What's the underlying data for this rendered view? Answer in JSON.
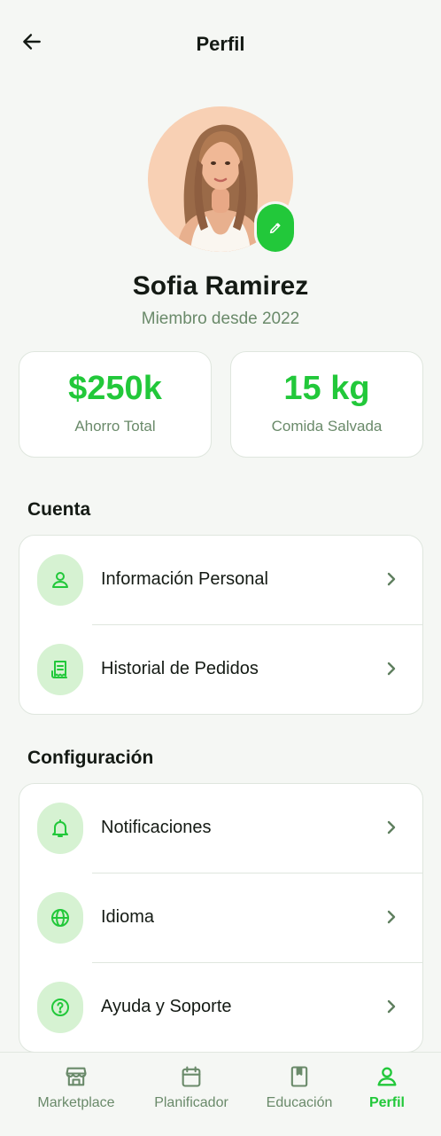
{
  "header": {
    "title": "Perfil"
  },
  "profile": {
    "name": "Sofia Ramirez",
    "member_since": "Miembro desde 2022"
  },
  "stats": [
    {
      "value": "$250k",
      "label": "Ahorro Total"
    },
    {
      "value": "15 kg",
      "label": "Comida Salvada"
    }
  ],
  "account": {
    "title": "Cuenta",
    "items": [
      {
        "label": "Información Personal",
        "icon": "person-icon"
      },
      {
        "label": "Historial de Pedidos",
        "icon": "receipt-icon"
      }
    ]
  },
  "settings": {
    "title": "Configuración",
    "items": [
      {
        "label": "Notificaciones",
        "icon": "bell-icon"
      },
      {
        "label": "Idioma",
        "icon": "globe-icon"
      },
      {
        "label": "Ayuda y Soporte",
        "icon": "help-icon"
      }
    ]
  },
  "tabbar": {
    "items": [
      {
        "label": "Marketplace",
        "icon": "store-icon",
        "active": false
      },
      {
        "label": "Planificador",
        "icon": "calendar-icon",
        "active": false
      },
      {
        "label": "Educación",
        "icon": "book-icon",
        "active": false
      },
      {
        "label": "Perfil",
        "icon": "person-icon",
        "active": true
      }
    ]
  },
  "colors": {
    "accent": "#22c83a",
    "accent_soft": "#d6f2d2",
    "muted_text": "#6a8a6a",
    "background": "#f5f7f4"
  }
}
